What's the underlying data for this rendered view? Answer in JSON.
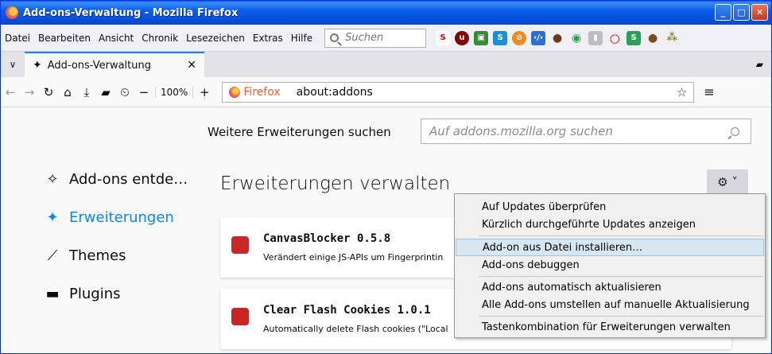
{
  "window": {
    "title": "Add-ons-Verwaltung - Mozilla Firefox"
  },
  "menubar": {
    "items": [
      "Datei",
      "Bearbeiten",
      "Ansicht",
      "Chronik",
      "Lesezeichen",
      "Extras",
      "Hilfe"
    ],
    "search_placeholder": "Suchen"
  },
  "tab": {
    "title": "Add-ons-Verwaltung"
  },
  "navbar": {
    "zoom": "100%",
    "url_brand": "Firefox",
    "url": "about:addons"
  },
  "content": {
    "find_label": "Weitere Erweiterungen suchen",
    "find_placeholder": "Auf addons.mozilla.org suchen",
    "sidebar": [
      {
        "label": "Add-ons entde…",
        "icon": "discover-icon"
      },
      {
        "label": "Erweiterungen",
        "icon": "puzzle-icon",
        "active": true
      },
      {
        "label": "Themes",
        "icon": "brush-icon"
      },
      {
        "label": "Plugins",
        "icon": "plugin-icon"
      }
    ],
    "heading": "Erweiterungen verwalten",
    "addons": [
      {
        "name": "CanvasBlocker 0.5.8",
        "description": "Verändert einige JS-APIs um Fingerprintin",
        "icon": "fingerprint-icon"
      },
      {
        "name": "Clear Flash Cookies 1.0.1",
        "description": "Automatically delete Flash cookies (\"Local",
        "icon": "cookie-icon"
      }
    ]
  },
  "gear_menu": {
    "items": [
      "Auf Updates überprüfen",
      "Kürzlich durchgeführte Updates anzeigen",
      "Add-on aus Datei installieren…",
      "Add-ons debuggen",
      "Add-ons automatisch aktualisieren",
      "Alle Add-ons umstellen auf manuelle Aktualisierung",
      "Tastenkombination für Erweiterungen verwalten"
    ],
    "highlighted_index": 2
  },
  "colors": {
    "accent": "#0a84ff",
    "titlebar": "#0a5fe9",
    "firefox_orange": "#ff5a1f"
  }
}
